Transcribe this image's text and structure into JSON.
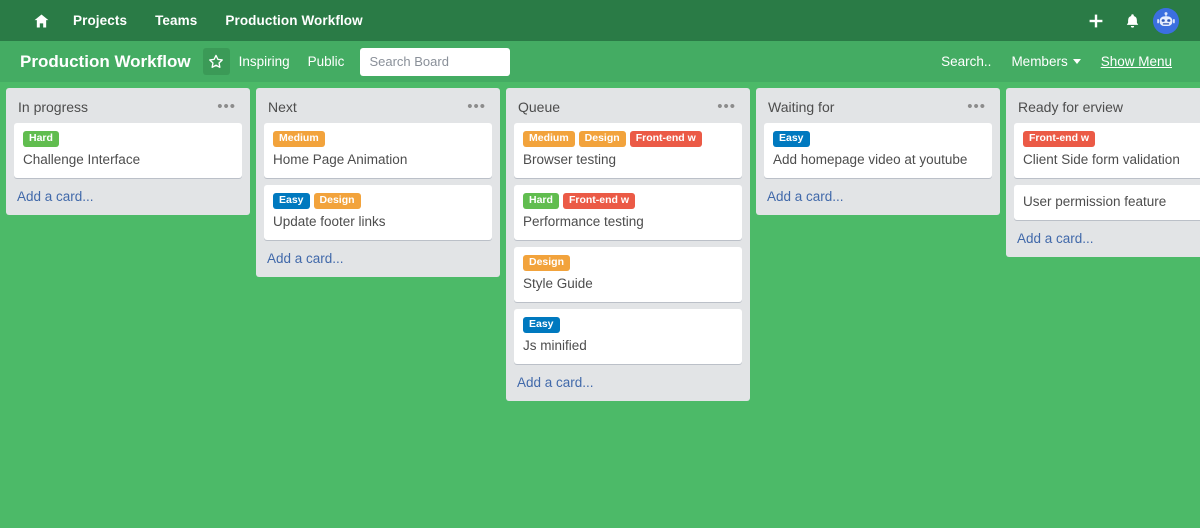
{
  "topnav": {
    "home_icon": "home-icon",
    "items": [
      {
        "label": "Projects"
      },
      {
        "label": "Teams"
      },
      {
        "label": "Production Workflow"
      }
    ],
    "actions": [
      {
        "name": "add-icon",
        "glyph": "+"
      },
      {
        "name": "notifications-icon",
        "glyph": "bell"
      }
    ],
    "avatar_name": "user-avatar-robot"
  },
  "boardbar": {
    "title": "Production Workflow",
    "star_icon": "star-icon",
    "visibility_team": "Inspiring",
    "visibility": "Public",
    "search_placeholder": "Search Board",
    "search_value": "",
    "right": {
      "search": "Search..",
      "members": "Members",
      "show_menu": "Show Menu"
    }
  },
  "colors": {
    "nav_bg": "#2a7b46",
    "board_header_bg": "#44ac63",
    "board_bg": "#4cba68",
    "list_bg": "#e2e4e6",
    "card_bg": "#ffffff",
    "label_green": "#61bd4f",
    "label_orange": "#f2a33c",
    "label_blue": "#0079bf",
    "label_red": "#eb5a46",
    "link_blue": "#4169aa",
    "text_gray": "#4d4d4d"
  },
  "board": {
    "menu_glyph": "•••",
    "add_card_label": "Add a card...",
    "lists": [
      {
        "title": "In progress",
        "has_menu": true,
        "cards": [
          {
            "title": "Challenge Interface",
            "labels": [
              {
                "text": "Hard",
                "color": "#61bd4f"
              }
            ]
          }
        ]
      },
      {
        "title": "Next",
        "has_menu": true,
        "cards": [
          {
            "title": "Home Page Animation",
            "labels": [
              {
                "text": "Medium",
                "color": "#f2a33c"
              }
            ]
          },
          {
            "title": "Update footer links",
            "labels": [
              {
                "text": "Easy",
                "color": "#0079bf"
              },
              {
                "text": "Design",
                "color": "#f2a33c"
              }
            ]
          }
        ]
      },
      {
        "title": "Queue",
        "has_menu": true,
        "cards": [
          {
            "title": "Browser testing",
            "labels": [
              {
                "text": "Medium",
                "color": "#f2a33c"
              },
              {
                "text": "Design",
                "color": "#f2a33c"
              },
              {
                "text": "Front-end w",
                "color": "#eb5a46"
              }
            ]
          },
          {
            "title": "Performance testing",
            "labels": [
              {
                "text": "Hard",
                "color": "#61bd4f"
              },
              {
                "text": "Front-end w",
                "color": "#eb5a46"
              }
            ]
          },
          {
            "title": "Style Guide",
            "labels": [
              {
                "text": "Design",
                "color": "#f2a33c"
              }
            ]
          },
          {
            "title": "Js minified",
            "labels": [
              {
                "text": "Easy",
                "color": "#0079bf"
              }
            ]
          }
        ]
      },
      {
        "title": "Waiting for",
        "has_menu": true,
        "cards": [
          {
            "title": "Add homepage video at youtube",
            "labels": [
              {
                "text": "Easy",
                "color": "#0079bf"
              }
            ]
          }
        ]
      },
      {
        "title": "Ready for erview",
        "has_menu": false,
        "cards": [
          {
            "title": "Client Side form validation",
            "labels": [
              {
                "text": "Front-end w",
                "color": "#eb5a46"
              }
            ]
          },
          {
            "title": "User permission feature",
            "labels": []
          }
        ]
      }
    ]
  }
}
